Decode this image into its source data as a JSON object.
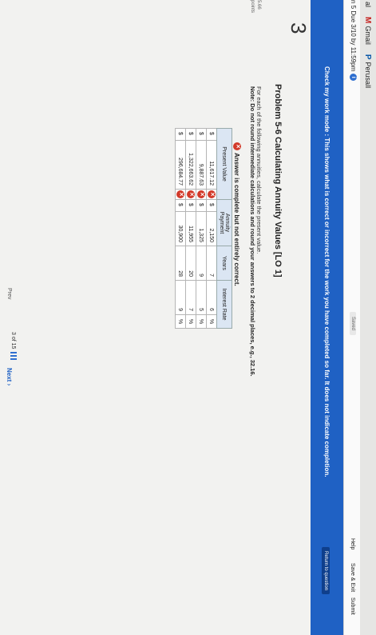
{
  "bookmarks": {
    "cut_label": "al",
    "gmail_label": "Gmail",
    "gmail_icon": "M",
    "perusall_label": "Perusall",
    "perusall_icon": "P"
  },
  "topbar": {
    "due_text": "n 5 Due 3/10 by 11:59pm",
    "saved_label": "Saved",
    "help_label": "Help",
    "save_exit_label": "Save & Exit",
    "submit_label": "Submit"
  },
  "banner": {
    "message": "Check my work mode : This shows what is correct or incorrect for the work you have completed so far. It does not indicate completion.",
    "return_label": "Return to question"
  },
  "question": {
    "number": "3",
    "score_line1": "5.66",
    "score_line2": "points",
    "title": "Problem 5-6 Calculating Annuity Values [LO 1]",
    "instruction": "For each of the following annuities, calculate the present value.",
    "note": "Note: Do not round intermediate calculations and round your answers to 2 decimal places, e.g., 32.16.",
    "status": "Answer is complete but not entirely correct.",
    "headers": {
      "present_value": "Present Value",
      "annuity_payment": "Annuity Payment",
      "years": "Years",
      "interest_rate": "Interest Rate"
    },
    "rows": [
      {
        "cur": "$",
        "pv": "11,617.12",
        "pay_cur": "$",
        "payment": "2,150",
        "years": "7",
        "rate": "6",
        "pct": "%"
      },
      {
        "cur": "$",
        "pv": "9,887.63",
        "pay_cur": "$",
        "payment": "1,325",
        "years": "9",
        "rate": "5",
        "pct": "%"
      },
      {
        "cur": "$",
        "pv": "1,322,663.62",
        "pay_cur": "$",
        "payment": "11,955",
        "years": "20",
        "rate": "7",
        "pct": "%"
      },
      {
        "cur": "$",
        "pv": "296,684.77",
        "pay_cur": "$",
        "payment": "30,900",
        "years": "28",
        "rate": "9",
        "pct": "%"
      }
    ]
  },
  "pager": {
    "prev_label": "Prev",
    "page_text": "3 of 15",
    "next_label": "Next"
  }
}
